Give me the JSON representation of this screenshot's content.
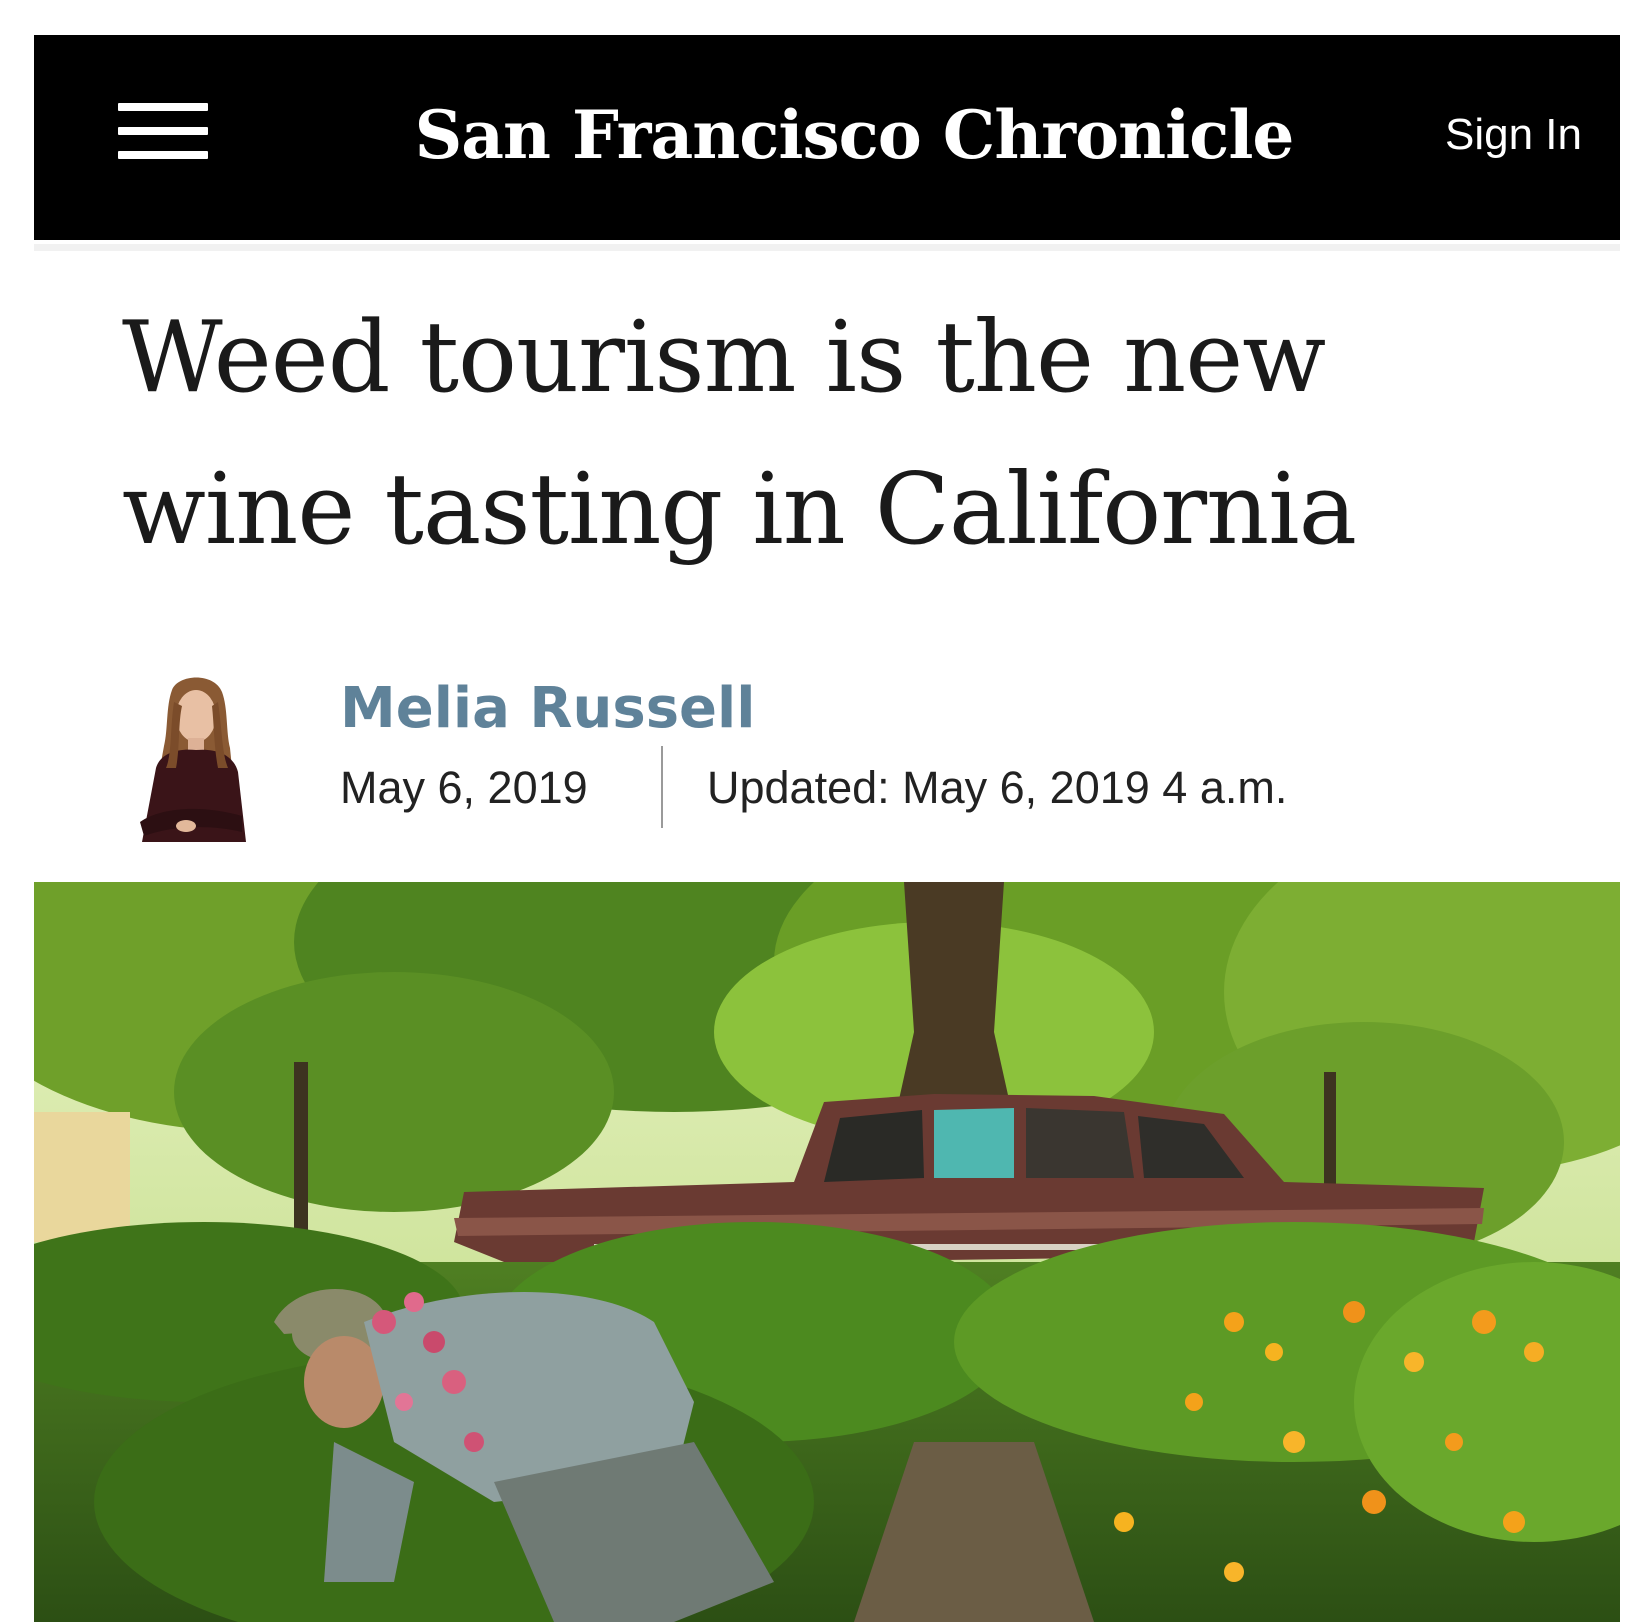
{
  "masthead": {
    "logo_text": "San Francisco Chronicle",
    "sign_in_label": "Sign In",
    "menu_icon": "hamburger-menu-icon",
    "background": "#000000"
  },
  "article": {
    "headline": "Weed tourism is the new wine tasting in California",
    "author": "Melia Russell",
    "author_color": "#5f8299",
    "published": "May 6, 2019",
    "updated": "Updated: May 6, 2019 4 a.m."
  }
}
